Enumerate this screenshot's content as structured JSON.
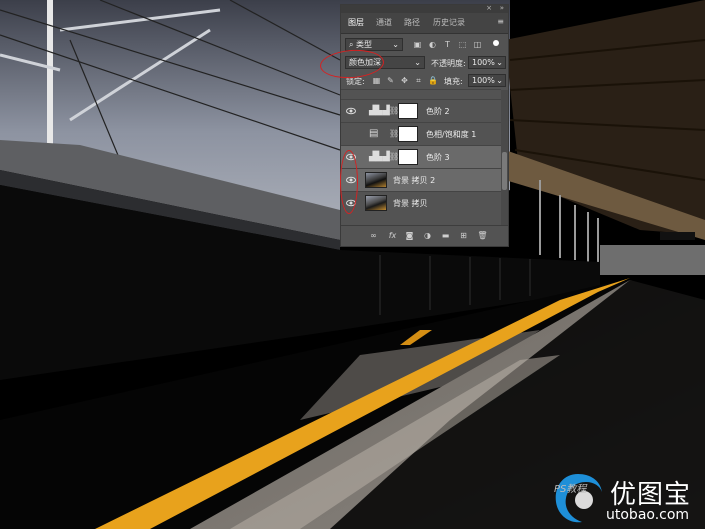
{
  "panel": {
    "tabs": [
      "图层",
      "通道",
      "路径",
      "历史记录"
    ],
    "active_tab": 0,
    "filter": "类型",
    "blend_mode": "颜色加深",
    "opacity_label": "不透明度:",
    "opacity_value": "100%",
    "lock_label": "锁定:",
    "fill_label": "填充:",
    "fill_value": "100%",
    "layers": [
      {
        "name": "色阶 2",
        "type": "levels",
        "visible": true,
        "selected": false
      },
      {
        "name": "色相/饱和度 1",
        "type": "hue-saturation",
        "visible": false,
        "selected": false
      },
      {
        "name": "色阶 3",
        "type": "levels",
        "visible": true,
        "selected": true
      },
      {
        "name": "背景 拷贝 2",
        "type": "image",
        "visible": true,
        "selected": true
      },
      {
        "name": "背景 拷贝",
        "type": "image",
        "visible": true,
        "selected": false
      }
    ]
  },
  "watermark": {
    "brand": "优图宝",
    "url": "utobao.com",
    "ps": "PS教程"
  },
  "colors": {
    "platform_stripe": "#e8a21c",
    "panel_bg": "#535353",
    "annotation": "#d42222"
  }
}
